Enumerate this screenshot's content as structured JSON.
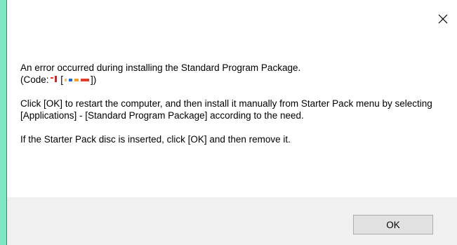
{
  "dialog": {
    "message": {
      "line1": "An error occurred during installing the Standard Program Package.",
      "code_prefix": "(Code:",
      "code_suffix": "])",
      "para2": "Click [OK] to restart the computer, and then install it manually from Starter Pack menu by selecting [Applications] - [Standard Program Package] according to the need.",
      "para3": "If the Starter Pack disc is inserted, click [OK] and then remove it."
    },
    "ok_label": "OK",
    "close_icon": "close-icon"
  },
  "colors": {
    "background": "#7ee8c4",
    "window": "#ffffff",
    "footer": "#f0f0f0",
    "button": "#e1e1e1",
    "redaction_blue": "#1e6fd0",
    "redaction_orange": "#f0a030",
    "redaction_red": "#e33b2a"
  }
}
